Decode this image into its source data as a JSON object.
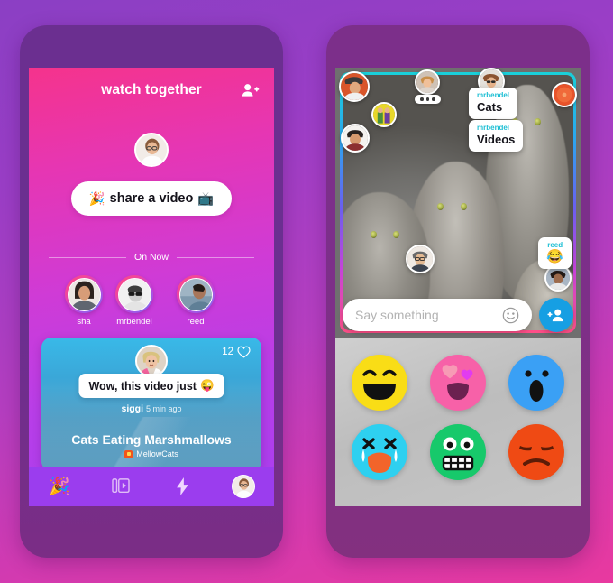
{
  "background": {
    "gradient_from": "#8b3fc4",
    "gradient_to": "#e8399f"
  },
  "left_phone": {
    "header": {
      "title": "watch together",
      "add_icon": "person-plus-icon"
    },
    "share_button": {
      "label": "share a video",
      "emoji_left": "🎉",
      "emoji_right": "📺"
    },
    "on_now": {
      "label": "On Now",
      "users": [
        {
          "name": "sha"
        },
        {
          "name": "mrbendel"
        },
        {
          "name": "reed"
        }
      ]
    },
    "video_card": {
      "like_count": "12",
      "like_icon": "heart-outline-icon",
      "comment": "Wow, this video just",
      "comment_emoji": "😜",
      "author": "siggi",
      "time": "5 min ago",
      "title": "Cats Eating Marshmallows",
      "channel": "MellowCats"
    },
    "nav": [
      {
        "icon": "party-popper-icon",
        "active": true
      },
      {
        "icon": "video-library-icon",
        "active": false
      },
      {
        "icon": "lightning-bolt-icon",
        "active": false
      },
      {
        "icon": "profile-avatar-icon",
        "active": false
      }
    ]
  },
  "right_phone": {
    "video": {
      "border_gradient": [
        "#19d0d9",
        "#2aa8ef",
        "#6a5ff0",
        "#c743d8",
        "#ff4f87"
      ],
      "typing_indicator": "...",
      "chat_messages": [
        {
          "user": "mrbendel",
          "text": "Cats"
        },
        {
          "user": "mrbendel",
          "text": "Videos"
        },
        {
          "user": "reed",
          "emoji": "😂"
        }
      ],
      "participants": [
        {
          "position": "top-left"
        },
        {
          "position": "top-left-lower"
        },
        {
          "position": "left"
        },
        {
          "position": "top-center"
        },
        {
          "position": "top-right-inner"
        },
        {
          "position": "top-right"
        },
        {
          "position": "center"
        },
        {
          "position": "bottom-right"
        }
      ]
    },
    "chat_input": {
      "placeholder": "Say something",
      "emoji_icon": "smiley-face-icon",
      "add_icon": "person-plus-icon"
    },
    "reactions": [
      {
        "name": "laughing",
        "color": "#f9dd16"
      },
      {
        "name": "love",
        "color": "#f761a8"
      },
      {
        "name": "shocked",
        "color": "#3aa0f5"
      },
      {
        "name": "crying",
        "color": "#2ed0f0"
      },
      {
        "name": "scared",
        "color": "#17c96b"
      },
      {
        "name": "annoyed",
        "color": "#ef4a14"
      }
    ]
  }
}
